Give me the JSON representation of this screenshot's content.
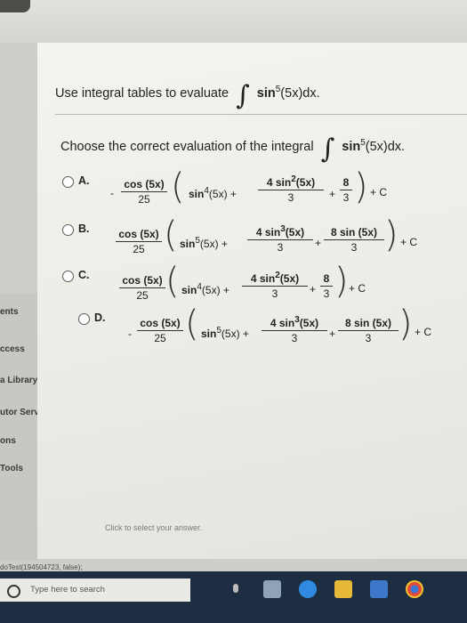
{
  "question": {
    "lead": "Use integral tables to evaluate",
    "integrand": "sin",
    "power": "5",
    "tail": "(5x)dx."
  },
  "prompt": {
    "lead": "Choose the correct evaluation of the integral",
    "integrand": "sin",
    "power": "5",
    "tail": "(5x)dx."
  },
  "options": [
    {
      "letter": "A.",
      "sign": "-",
      "coef_num": "cos (5x)",
      "coef_den": "25",
      "t1_func": "sin",
      "t1_pow": "4",
      "t1_arg": "(5x) +",
      "t2_num_a": "4 sin",
      "t2_num_pow": "2",
      "t2_num_b": "(5x)",
      "t2_den": "3",
      "op": "+",
      "t3_num": "8",
      "t3_den": "3",
      "c": "+ C"
    },
    {
      "letter": "B.",
      "sign": "",
      "coef_num": "cos (5x)",
      "coef_den": "25",
      "t1_func": "sin",
      "t1_pow": "5",
      "t1_arg": "(5x) +",
      "t2_num_a": "4 sin",
      "t2_num_pow": "3",
      "t2_num_b": "(5x)",
      "t2_den": "3",
      "op": "+",
      "t3_num": "8 sin (5x)",
      "t3_den": "3",
      "c": "+ C"
    },
    {
      "letter": "C.",
      "sign": "",
      "coef_num": "cos (5x)",
      "coef_den": "25",
      "t1_func": "sin",
      "t1_pow": "4",
      "t1_arg": "(5x) +",
      "t2_num_a": "4 sin",
      "t2_num_pow": "2",
      "t2_num_b": "(5x)",
      "t2_den": "3",
      "op": "+",
      "t3_num": "8",
      "t3_den": "3",
      "c": "+ C"
    },
    {
      "letter": "D.",
      "sign": "-",
      "coef_num": "cos (5x)",
      "coef_den": "25",
      "t1_func": "sin",
      "t1_pow": "5",
      "t1_arg": "(5x) +",
      "t2_num_a": "4 sin",
      "t2_num_pow": "3",
      "t2_num_b": "(5x)",
      "t2_den": "3",
      "op": "+",
      "t3_num": "8 sin (5x)",
      "t3_den": "3",
      "c": "+ C"
    }
  ],
  "hint": "Click to select your answer.",
  "nav": [
    "ents",
    "ccess",
    "a Library",
    "utor Services",
    "ons",
    "Tools"
  ],
  "status_text": "doTest(194504723, false);",
  "taskbar": {
    "search_placeholder": "Type here to search",
    "icon_names": [
      "task-view-icon",
      "edge-icon",
      "file-explorer-icon",
      "store-icon",
      "chrome-icon"
    ]
  }
}
